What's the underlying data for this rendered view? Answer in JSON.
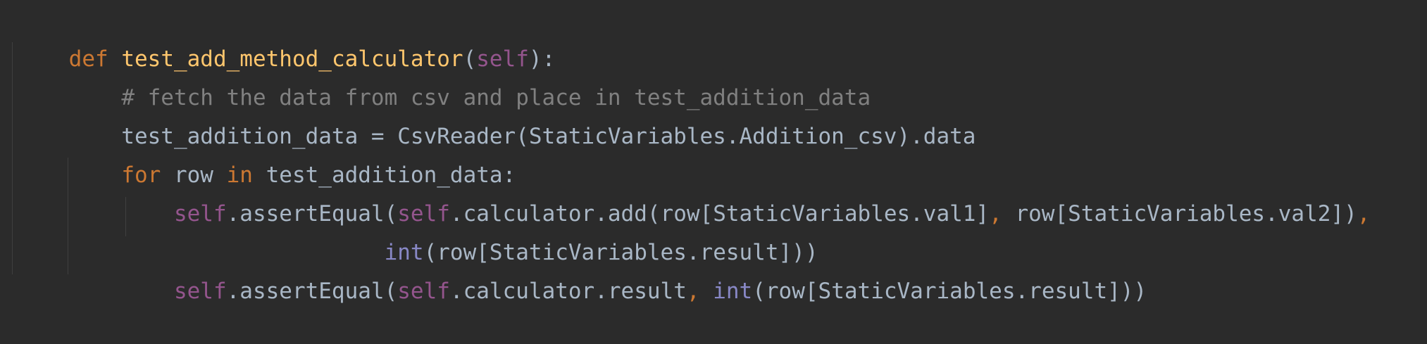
{
  "lines": [
    {
      "tokens": [
        {
          "text": "def",
          "kind": "keyword"
        },
        {
          "text": " ",
          "kind": "text"
        },
        {
          "text": "test_add_method_calculator",
          "kind": "function"
        },
        {
          "text": "(",
          "kind": "text"
        },
        {
          "text": "self",
          "kind": "self"
        },
        {
          "text": "):",
          "kind": "text"
        }
      ]
    },
    {
      "tokens": [
        {
          "text": "    ",
          "kind": "text"
        },
        {
          "text": "# fetch the data from csv and place in test_addition_data",
          "kind": "comment"
        }
      ]
    },
    {
      "tokens": [
        {
          "text": "    test_addition_data = CsvReader(StaticVariables.Addition_csv).data",
          "kind": "text"
        }
      ]
    },
    {
      "tokens": [
        {
          "text": "    ",
          "kind": "text"
        },
        {
          "text": "for",
          "kind": "keyword"
        },
        {
          "text": " row ",
          "kind": "text"
        },
        {
          "text": "in",
          "kind": "keyword"
        },
        {
          "text": " test_addition_data:",
          "kind": "text"
        }
      ]
    },
    {
      "tokens": [
        {
          "text": "        ",
          "kind": "text"
        },
        {
          "text": "self",
          "kind": "self"
        },
        {
          "text": ".assertEqual(",
          "kind": "text"
        },
        {
          "text": "self",
          "kind": "self"
        },
        {
          "text": ".calculator.add(row[StaticVariables.val1]",
          "kind": "text"
        },
        {
          "text": ",",
          "kind": "keyword"
        },
        {
          "text": " row[StaticVariables.val2])",
          "kind": "text"
        },
        {
          "text": ",",
          "kind": "keyword"
        }
      ]
    },
    {
      "tokens": [
        {
          "text": "                        ",
          "kind": "text"
        },
        {
          "text": "int",
          "kind": "builtin"
        },
        {
          "text": "(row[StaticVariables.result]))",
          "kind": "text"
        }
      ]
    },
    {
      "tokens": [
        {
          "text": "        ",
          "kind": "text"
        },
        {
          "text": "self",
          "kind": "self"
        },
        {
          "text": ".assertEqual(",
          "kind": "text"
        },
        {
          "text": "self",
          "kind": "self"
        },
        {
          "text": ".calculator.result",
          "kind": "text"
        },
        {
          "text": ",",
          "kind": "keyword"
        },
        {
          "text": " ",
          "kind": "text"
        },
        {
          "text": "int",
          "kind": "builtin"
        },
        {
          "text": "(row[StaticVariables.result]))",
          "kind": "text"
        }
      ]
    }
  ],
  "theme": {
    "background": "#2b2b2b",
    "text": "#a9b7c6",
    "keyword": "#cc7832",
    "function": "#ffc66d",
    "self": "#94558d",
    "comment": "#808080",
    "builtin": "#8888c6",
    "indent_guide": "#3f3f3f"
  }
}
